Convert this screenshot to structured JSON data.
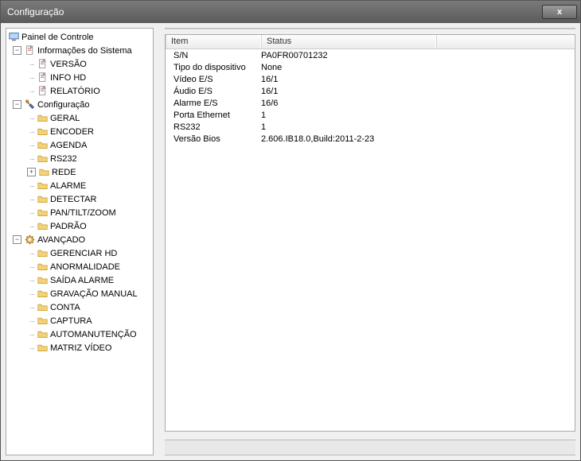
{
  "window": {
    "title": "Configuração",
    "close_symbol": "x"
  },
  "sidebar": {
    "root": "Painel de Controle",
    "groups": [
      {
        "label": "Informações do Sistema",
        "icon": "doc",
        "expand": "−",
        "children": [
          {
            "label": "VERSÃO",
            "icon": "doc"
          },
          {
            "label": "INFO HD",
            "icon": "doc"
          },
          {
            "label": "RELATÓRIO",
            "icon": "doc"
          }
        ]
      },
      {
        "label": "Configuração",
        "icon": "tool",
        "expand": "−",
        "children": [
          {
            "label": "GERAL",
            "icon": "folder"
          },
          {
            "label": "ENCODER",
            "icon": "folder"
          },
          {
            "label": "AGENDA",
            "icon": "folder"
          },
          {
            "label": "RS232",
            "icon": "folder"
          },
          {
            "label": "REDE",
            "icon": "folder",
            "expand": "+"
          },
          {
            "label": "ALARME",
            "icon": "folder"
          },
          {
            "label": "DETECTAR",
            "icon": "folder"
          },
          {
            "label": "PAN/TILT/ZOOM",
            "icon": "folder"
          },
          {
            "label": "PADRÃO",
            "icon": "folder"
          }
        ]
      },
      {
        "label": "AVANÇADO",
        "icon": "gear",
        "expand": "−",
        "children": [
          {
            "label": "GERENCIAR HD",
            "icon": "folder"
          },
          {
            "label": "ANORMALIDADE",
            "icon": "folder"
          },
          {
            "label": "SAÍDA ALARME",
            "icon": "folder"
          },
          {
            "label": "GRAVAÇÃO MANUAL",
            "icon": "folder"
          },
          {
            "label": "CONTA",
            "icon": "folder"
          },
          {
            "label": "CAPTURA",
            "icon": "folder"
          },
          {
            "label": "AUTOMANUTENÇÃO",
            "icon": "folder"
          },
          {
            "label": "MATRIZ VÍDEO",
            "icon": "folder"
          }
        ]
      }
    ]
  },
  "listview": {
    "columns": [
      "Item",
      "Status",
      ""
    ],
    "rows": [
      {
        "item": "S/N",
        "status": "PA0FR00701232"
      },
      {
        "item": "Tipo do dispositivo",
        "status": "None"
      },
      {
        "item": "Vídeo E/S",
        "status": "16/1"
      },
      {
        "item": "Áudio E/S",
        "status": "16/1"
      },
      {
        "item": "Alarme E/S",
        "status": "16/6"
      },
      {
        "item": "Porta Ethernet",
        "status": "1"
      },
      {
        "item": "RS232",
        "status": "1"
      },
      {
        "item": "Versão Bios",
        "status": "2.606.IB18.0,Build:2011-2-23"
      }
    ]
  }
}
